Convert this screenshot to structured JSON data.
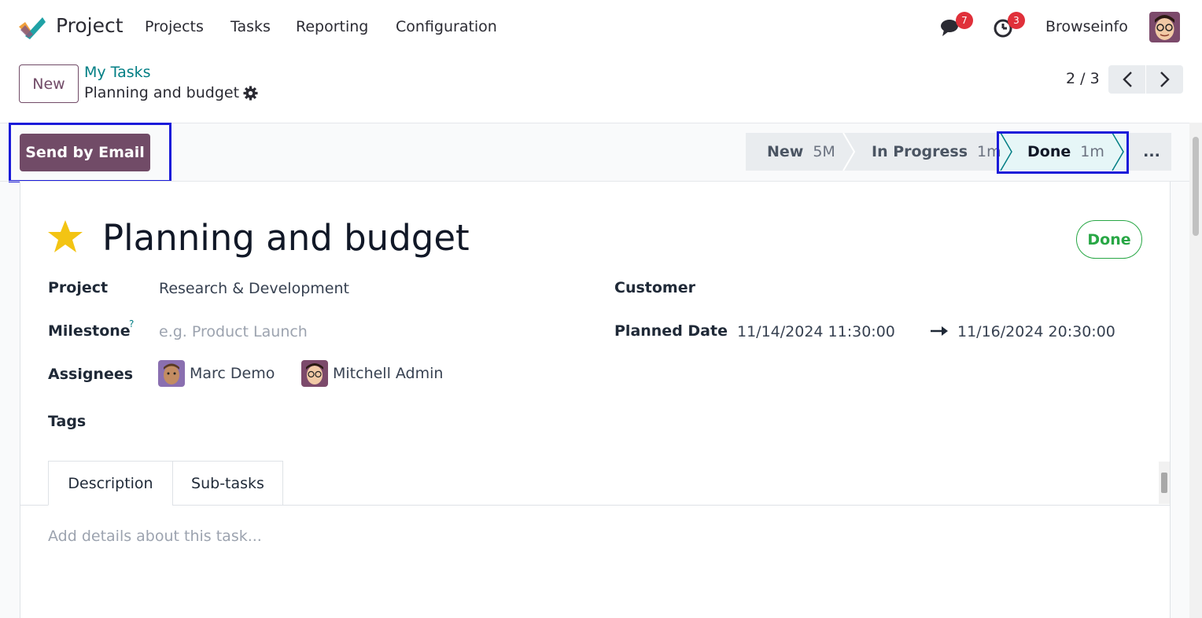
{
  "app": {
    "name": "Project"
  },
  "nav": {
    "menu": [
      "Projects",
      "Tasks",
      "Reporting",
      "Configuration"
    ],
    "messages_count": "7",
    "activities_count": "3",
    "user": "Browseinfo"
  },
  "control": {
    "new_label": "New",
    "breadcrumb_parent": "My Tasks",
    "breadcrumb_current": "Planning and budget",
    "pager": "2 / 3"
  },
  "actions": {
    "send_email": "Send by Email"
  },
  "stages": [
    {
      "name": "New",
      "duration": "5M"
    },
    {
      "name": "In Progress",
      "duration": "1m"
    },
    {
      "name": "Done",
      "duration": "1m"
    }
  ],
  "more_label": "...",
  "task": {
    "title": "Planning and budget",
    "state": "Done",
    "project_label": "Project",
    "project": "Research & Development",
    "milestone_label": "Milestone",
    "milestone_help": "?",
    "milestone_placeholder": "e.g. Product Launch",
    "assignees_label": "Assignees",
    "assignees": [
      "Marc Demo",
      "Mitchell Admin"
    ],
    "tags_label": "Tags",
    "customer_label": "Customer",
    "planned_label": "Planned Date",
    "planned_start": "11/14/2024 11:30:00",
    "planned_end": "11/16/2024 20:30:00"
  },
  "tabs": [
    "Description",
    "Sub-tasks"
  ],
  "description_placeholder": "Add details about this task...",
  "colors": {
    "primary": "#714b67",
    "accent": "#017e84",
    "success": "#28a745",
    "highlight": "#1a1ad9",
    "badge": "#e0303a"
  }
}
